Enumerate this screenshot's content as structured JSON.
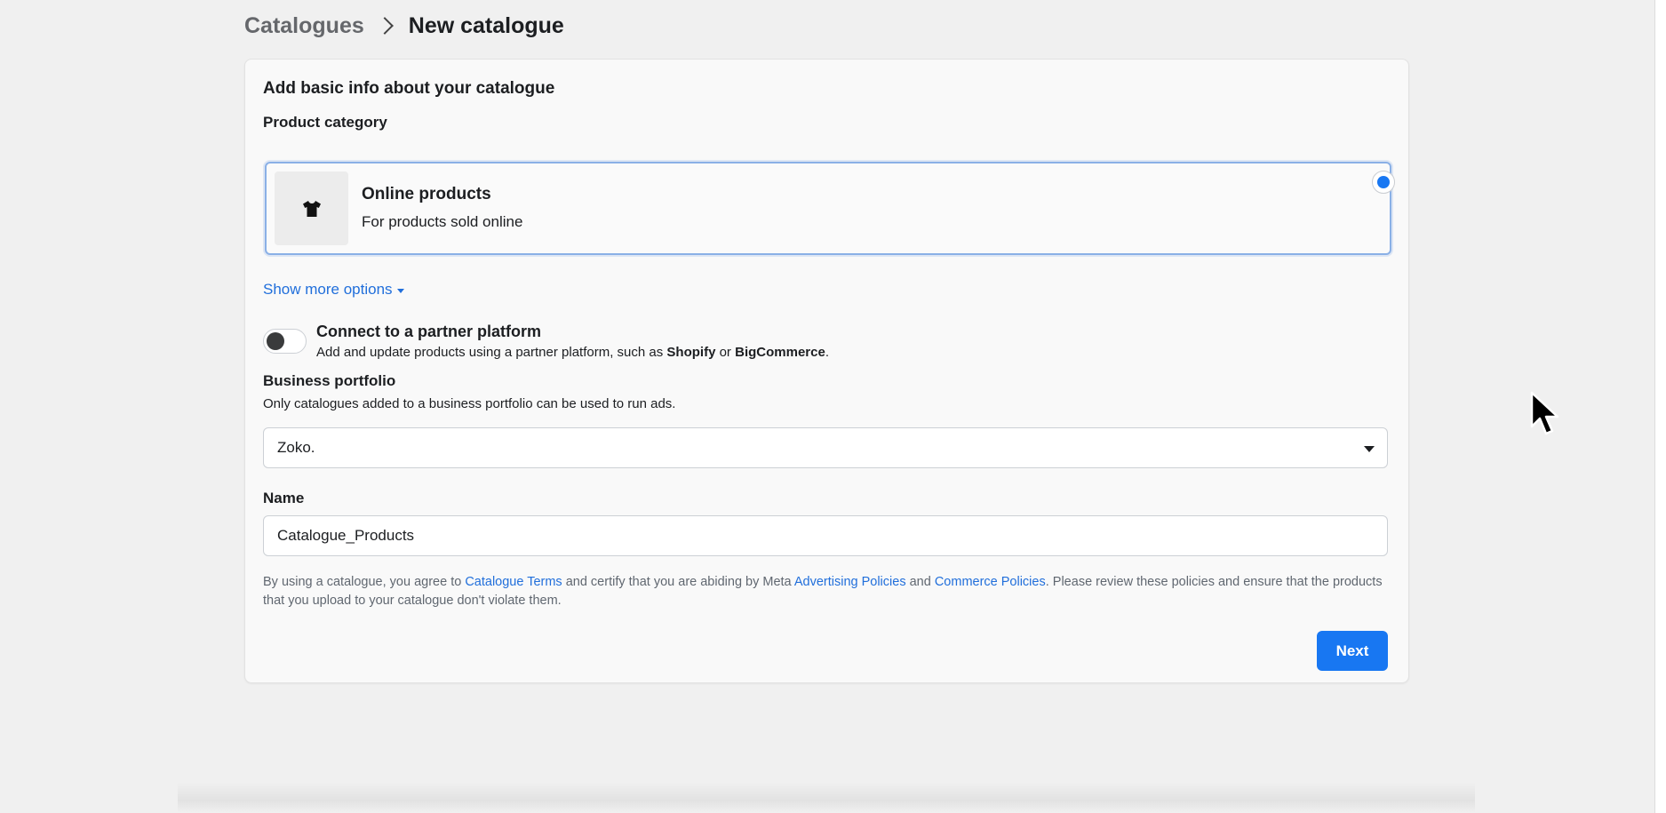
{
  "breadcrumb": {
    "parent": "Catalogues",
    "current": "New catalogue"
  },
  "card": {
    "title": "Add basic info about your catalogue",
    "product_category_label": "Product category",
    "option": {
      "icon": "tshirt-icon",
      "title": "Online products",
      "description": "For products sold online",
      "selected": true
    },
    "show_more": "Show more options",
    "partner": {
      "title": "Connect to a partner platform",
      "desc_prefix": "Add and update products using a partner platform, such as ",
      "platform1": "Shopify",
      "desc_mid": " or ",
      "platform2": "BigCommerce",
      "desc_suffix": ".",
      "enabled": false
    },
    "business_portfolio": {
      "label": "Business portfolio",
      "helper": "Only catalogues added to a business portfolio can be used to run ads.",
      "value": "Zoko."
    },
    "name": {
      "label": "Name",
      "value": "Catalogue_Products"
    },
    "terms": {
      "t1": "By using a catalogue, you agree to ",
      "link1": "Catalogue Terms",
      "t2": " and certify that you are abiding by Meta ",
      "link2": "Advertising Policies",
      "t3": " and ",
      "link3": "Commerce Policies",
      "t4": ". Please review these policies and ensure that the products that you upload to your catalogue don't violate them."
    },
    "next_label": "Next"
  },
  "colors": {
    "primary": "#1877f2",
    "link": "#216fdb",
    "background": "#f0f0f0"
  }
}
